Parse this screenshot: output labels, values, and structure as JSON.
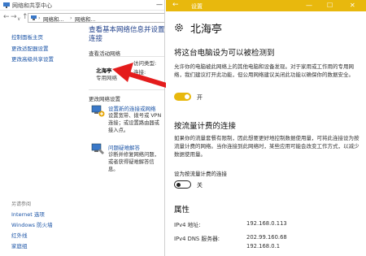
{
  "nsc": {
    "title": "网络和共享中心",
    "min_glyph": "—",
    "nav": {
      "back": "←",
      "forward": "→",
      "down": "∨",
      "up": "↑"
    },
    "breadcrumb": [
      "网络和...",
      "›",
      "网络和..."
    ],
    "sidebar": {
      "links": [
        "控制面板主页",
        "更改适配器设置",
        "更改高级共享设置"
      ],
      "see_also_title": "另请参阅",
      "see_also": [
        "Internet 选项",
        "Windows 防火墙",
        "红外线",
        "家庭组"
      ]
    },
    "main": {
      "heading_line1": "查看基本网络信息并设置",
      "heading_line2": "连接",
      "active_networks": "查看活动网络",
      "network_name": "北海亭",
      "network_type": "专用网络",
      "access_type": "访问类型:",
      "connections": "连接:",
      "change_settings": "更改网络设置",
      "item1_link": "设置新的连接或网络",
      "item1_desc": "设置宽带、拨号或 VPN 连接；或设置路由器或接入点。",
      "item2_link": "问题疑难解答",
      "item2_desc": "诊断并修复网络问题，或者获得疑难解答信息。"
    }
  },
  "settings": {
    "window_title": "设置",
    "back_glyph": "←",
    "win_buttons": [
      "—",
      "☐",
      "✕"
    ],
    "network_name": "北海亭",
    "discoverable": {
      "heading": "将这台电脑设为可以被检测到",
      "text": "允许你的电脑被此网络上的其他电脑和设备发现。对于家用或工作用的专用网络，我们建议打开此功能，但公用网络建议关闭此功能以确保你的数据安全。",
      "toggle_state": "开",
      "toggle_on": true
    },
    "metered": {
      "heading": "按流量计费的连接",
      "text": "如果你的流量套餐有限制，因此想要更好地控制数据使用量，可将此连接设为按流量计费的网络。当你连接到此网络时，某些应用可能会改变工作方式，以减少数据使用量。",
      "toggle_label": "设为按流量计费的连接",
      "toggle_state": "关",
      "toggle_on": false
    },
    "properties": {
      "heading": "属性",
      "ipv4_label": "IPv4 地址:",
      "ipv4_value": "192.168.0.113",
      "dns_label": "IPv4 DNS 服务器:",
      "dns_values": [
        "202.99.160.68",
        "192.168.0.1"
      ]
    }
  },
  "colors": {
    "accent": "#e8b80d",
    "link": "#1a53a6",
    "heading_blue": "#1e3f8a",
    "arrow": "#e41c1c"
  }
}
